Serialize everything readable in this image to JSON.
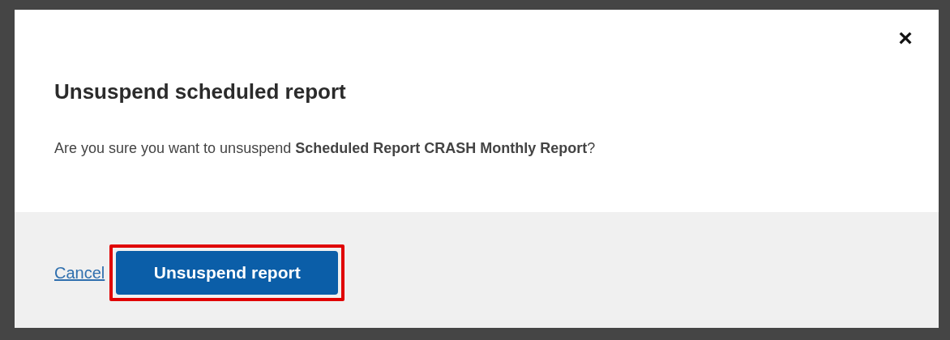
{
  "dialog": {
    "close": "×",
    "title": "Unsuspend scheduled report",
    "message": "Are you sure you want to unsuspend **Scheduled Report CRASH Monthly Report**?"
  },
  "footer": {
    "cancel": "Cancel",
    "confirm": {
      "label": "Unsuspend report",
      "highlighted": true
    }
  }
}
